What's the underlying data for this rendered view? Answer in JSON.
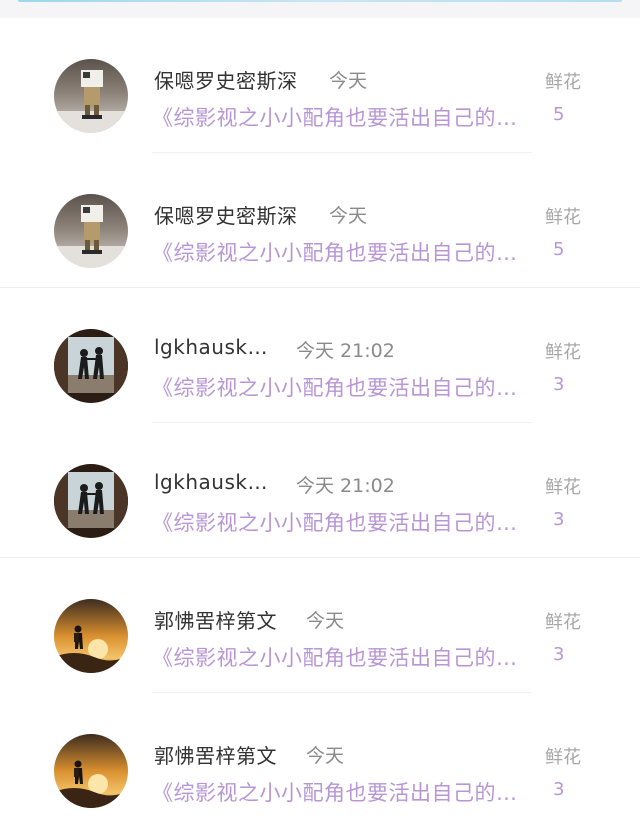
{
  "rows": [
    {
      "username": "保嗯罗史密斯深",
      "time": "今天",
      "book": "《综影视之小小配角也要活出自己的…",
      "gift": "鲜花",
      "count": "5",
      "avatar_icon": "toy-figure-avatar"
    },
    {
      "username": "保嗯罗史密斯深",
      "time": "今天",
      "book": "《综影视之小小配角也要活出自己的…",
      "gift": "鲜花",
      "count": "5",
      "avatar_icon": "toy-figure-avatar"
    },
    {
      "username": "lgkhausk…",
      "time": "今天 21:02",
      "book": "《综影视之小小配角也要活出自己的…",
      "gift": "鲜花",
      "count": "3",
      "avatar_icon": "couple-silhouette-avatar"
    },
    {
      "username": "lgkhausk…",
      "time": "今天 21:02",
      "book": "《综影视之小小配角也要活出自己的…",
      "gift": "鲜花",
      "count": "3",
      "avatar_icon": "couple-silhouette-avatar"
    },
    {
      "username": "郭怫罟梓第文",
      "time": "今天",
      "book": "《综影视之小小配角也要活出自己的…",
      "gift": "鲜花",
      "count": "3",
      "avatar_icon": "hiker-sunset-avatar"
    },
    {
      "username": "郭怫罟梓第文",
      "time": "今天",
      "book": "《综影视之小小配角也要活出自己的…",
      "gift": "鲜花",
      "count": "3",
      "avatar_icon": "hiker-sunset-avatar"
    }
  ],
  "colors": {
    "title_purple": "#b896d6",
    "username": "#333333",
    "meta_gray": "#8a8a8a"
  }
}
